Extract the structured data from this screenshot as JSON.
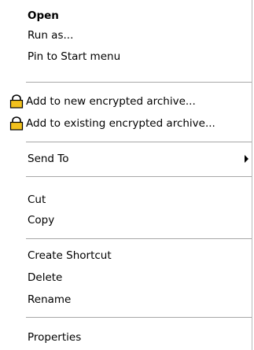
{
  "menu": {
    "open": "Open",
    "run_as": "Run as...",
    "pin_start": "Pin to Start menu",
    "add_new_encrypted": "Add to new encrypted archive...",
    "add_existing_encrypted": "Add to existing encrypted archive...",
    "send_to": "Send To",
    "cut": "Cut",
    "copy": "Copy",
    "create_shortcut": "Create Shortcut",
    "delete": "Delete",
    "rename": "Rename",
    "properties": "Properties"
  },
  "icons": {
    "lock": "lock-icon",
    "submenu": "chevron-right-icon"
  },
  "colors": {
    "separator": "#a7a7a7",
    "lock_body": "#f2c11d",
    "lock_outline": "#000000"
  }
}
